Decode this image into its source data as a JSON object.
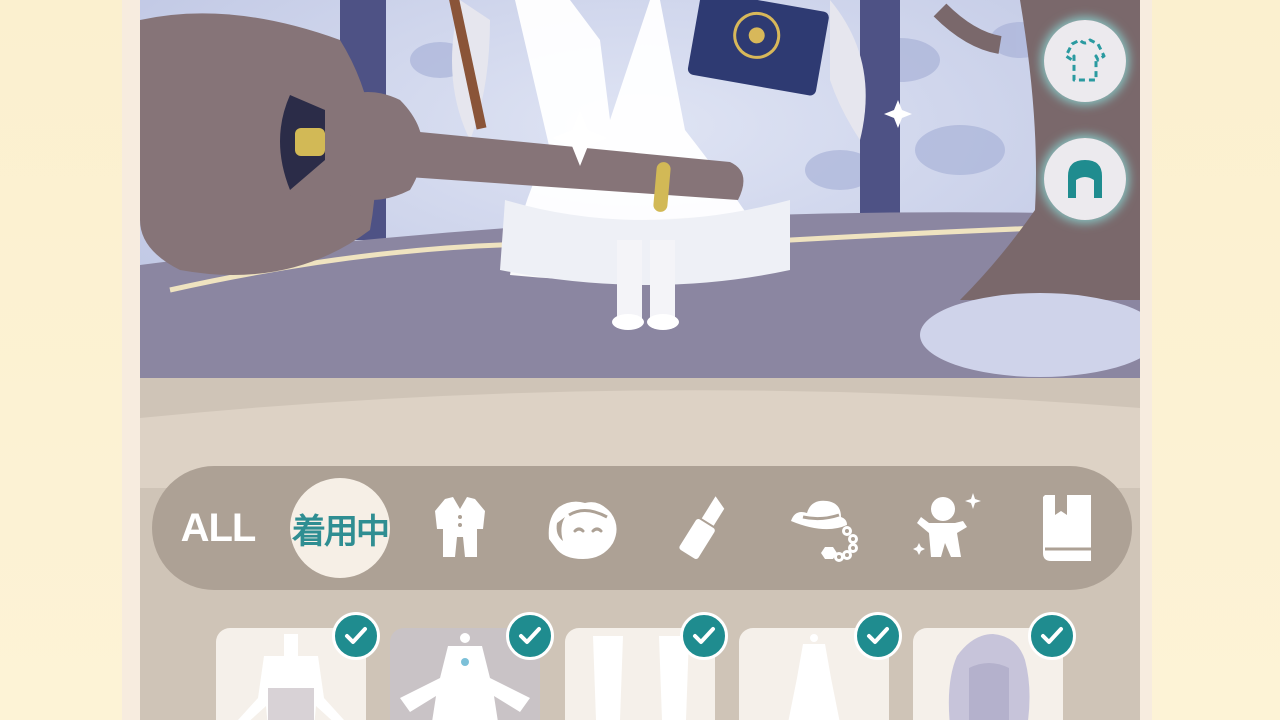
{
  "colors": {
    "accent_teal": "#1f8c8f",
    "active_tab_text": "#2f8e92",
    "category_bar": "#ada195",
    "panel_bg": "#cfc4b7",
    "page_bg": "#fbf0cf"
  },
  "side_buttons": [
    {
      "icon": "outfit-edit-icon"
    },
    {
      "icon": "hairstyle-icon"
    }
  ],
  "categories": {
    "all_label": "ALL",
    "worn_label": "着用中",
    "active_index": 1,
    "icons": [
      "clothing-icon",
      "face-icon",
      "makeup-icon",
      "accessory-icon",
      "pose-icon",
      "book-icon"
    ]
  },
  "items": [
    {
      "icon": "shirt-outfit-icon",
      "checked": true,
      "selected": false
    },
    {
      "icon": "white-dress-icon",
      "checked": true,
      "selected": true
    },
    {
      "icon": "stockings-icon",
      "checked": true,
      "selected": false
    },
    {
      "icon": "gown-icon",
      "checked": true,
      "selected": false
    },
    {
      "icon": "long-hair-icon",
      "checked": true,
      "selected": false
    }
  ]
}
